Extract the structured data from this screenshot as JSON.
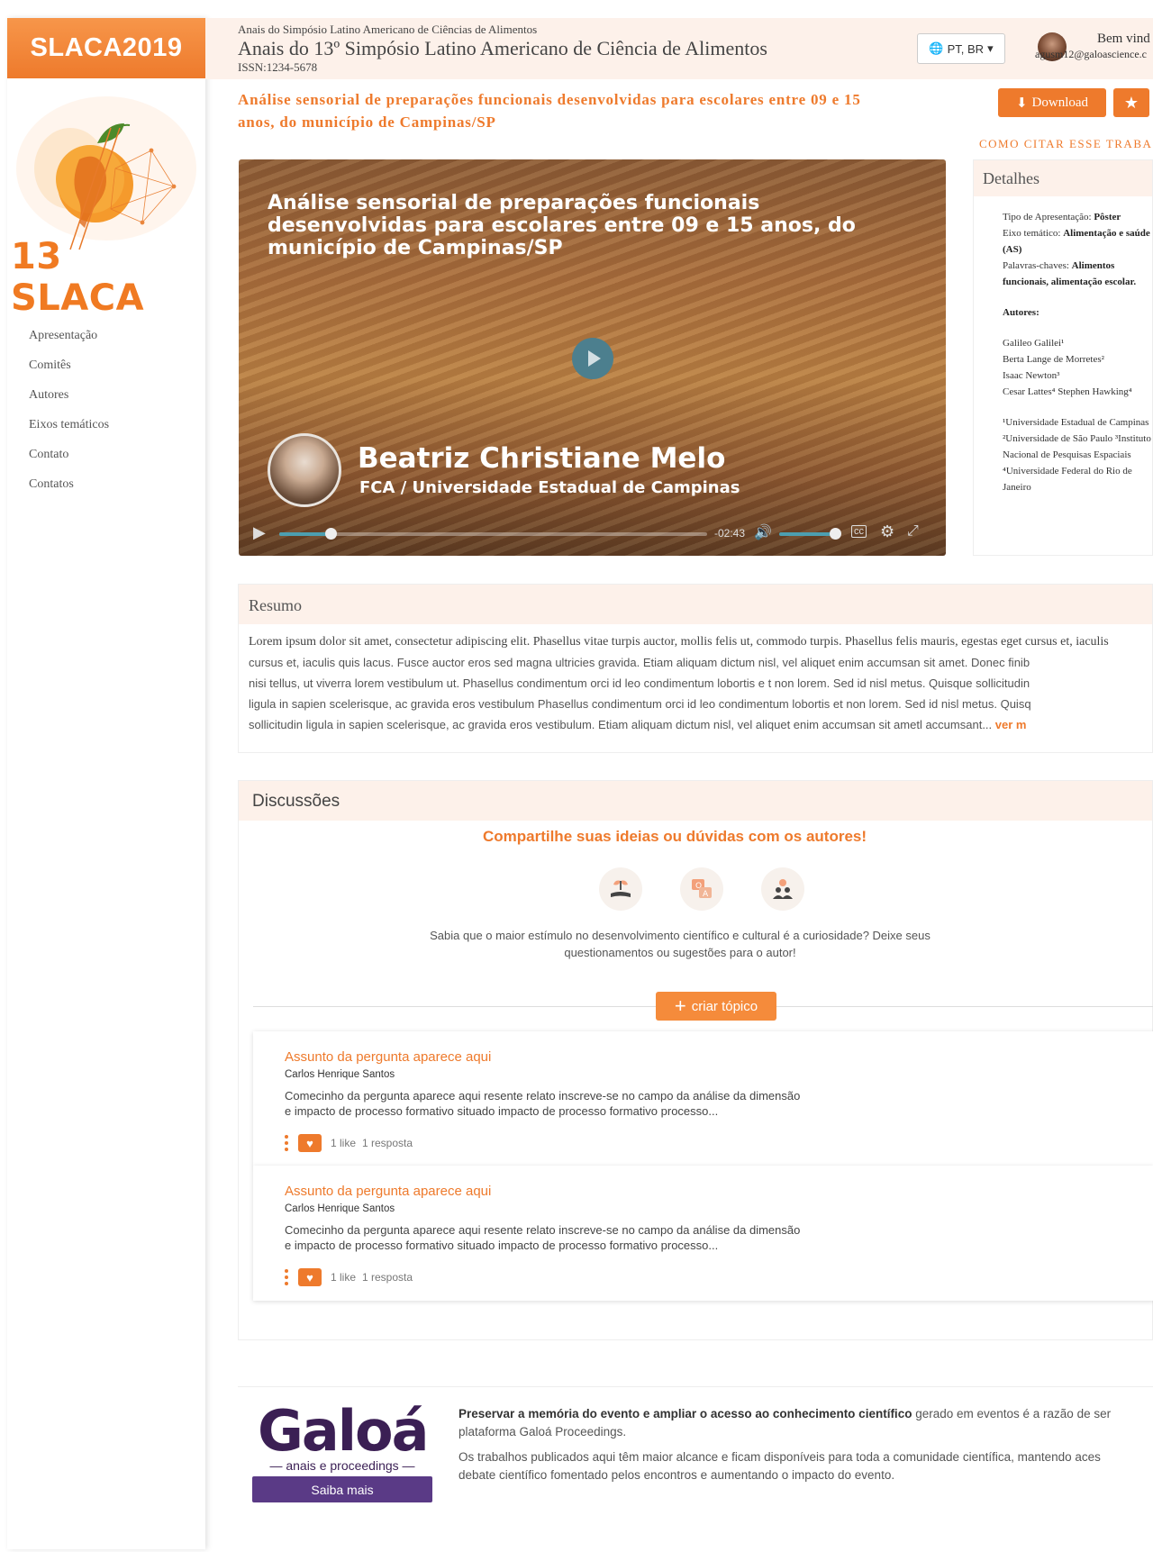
{
  "sidebar": {
    "brand": "SLACA2019",
    "logo_text": "13 SLACA",
    "items": [
      {
        "label": "Apresentação"
      },
      {
        "label": "Comitês"
      },
      {
        "label": "Autores"
      },
      {
        "label": "Eixos temáticos"
      },
      {
        "label": "Contato"
      },
      {
        "label": "Contatos"
      }
    ]
  },
  "header": {
    "small": "Anais do Simpósio Latino Americano de Ciências de Alimentos",
    "title": "Anais do 13º Simpósio Latino Americano de Ciência de Alimentos",
    "issn": "ISSN:1234-5678",
    "language": "PT, BR",
    "welcome": "Bem vind",
    "email": "agusm12@galoascience.c"
  },
  "article": {
    "title": "Análise sensorial de preparações funcionais desenvolvidas para escolares entre 09 e 15 anos, do município de Campinas/SP",
    "download_label": "Download",
    "cite_label": "COMO CITAR ESSE TRABA"
  },
  "video": {
    "title": "Análise sensorial de preparações funcionais desenvolvidas para escolares entre 09 e 15 anos, do município de Campinas/SP",
    "presenter_name": "Beatriz Christiane Melo",
    "presenter_affiliation": "FCA / Universidade Estadual de Campinas",
    "time_remaining": "-02:43",
    "progress": 0.12,
    "volume": 1.0
  },
  "details": {
    "heading": "Detalhes",
    "tipo_label": "Tipo de Apresentação: ",
    "tipo_value": "Pôster",
    "eixo_label": "Eixo temático: ",
    "eixo_value": "Alimentação e saúde (AS)",
    "palavras_label": "Palavras-chaves: ",
    "palavras_value": "Alimentos funcionais, alimentação escolar.",
    "autores_label": "Autores:",
    "authors": [
      "Galileo Galilei¹",
      "Berta Lange de Morretes²",
      "Isaac Newton³",
      "Cesar Lattes⁴ Stephen Hawking⁴"
    ],
    "affiliations": "¹Universidade Estadual de Campinas ²Universidade de São Paulo ³Instituto Nacional de Pesquisas Espaciais ⁴Universidade Federal do Rio de Janeiro"
  },
  "resumo": {
    "heading": "Resumo",
    "line1": "Lorem ipsum dolor sit amet, consectetur adipiscing elit. Phasellus vitae turpis auctor, mollis felis ut, commodo turpis. Phasellus felis mauris, egestas eget cursus et, iaculis",
    "line2": "cursus et, iaculis quis lacus. Fusce auctor eros sed magna ultricies gravida. Etiam aliquam dictum nisl, vel aliquet enim accumsan sit amet. Donec finib",
    "line3": "nisi tellus, ut viverra lorem vestibulum ut. Phasellus condimentum orci id leo condimentum lobortis e t non lorem. Sed id nisl metus. Quisque sollicitudin",
    "line4": "ligula in sapien scelerisque, ac gravida eros vestibulum Phasellus condimentum orci id leo condimentum lobortis et non lorem. Sed id nisl metus. Quisq",
    "line5": "sollicitudin ligula in sapien scelerisque, ac gravida eros vestibulum. Etiam aliquam dictum nisl, vel aliquet enim accumsan sit ametl accumsant...",
    "more": "ver m"
  },
  "discussions": {
    "heading": "Discussões",
    "cta": "Compartilhe suas ideias ou dúvidas com os autores!",
    "text": "Sabia que o maior estímulo no desenvolvimento científico e cultural é a curiosidade? Deixe seus questionamentos ou sugestões para o autor!",
    "create_topic": "criar tópico",
    "icons": [
      "plant-hand-icon",
      "qa-icon",
      "people-icon"
    ],
    "topics": [
      {
        "title": "Assunto da pergunta aparece aqui",
        "author": "Carlos Henrique Santos",
        "body": "Comecinho da pergunta aparece aqui resente relato inscreve-se no campo da análise da dimensão e impacto de processo formativo situado impacto de processo formativo processo...",
        "likes": "1 like",
        "replies": "1 resposta"
      },
      {
        "title": "Assunto da pergunta aparece aqui",
        "author": "Carlos Henrique Santos",
        "body": "Comecinho da pergunta aparece aqui resente relato inscreve-se no campo da análise da dimensão e impacto de processo formativo situado impacto de processo formativo processo...",
        "likes": "1 like",
        "replies": "1 resposta"
      }
    ]
  },
  "footer": {
    "logo": "Galoá",
    "logo_sub": "— anais e proceedings —",
    "saiba_mais": "Saiba mais",
    "p1_bold": "Preservar a memória do evento e ampliar o acesso ao conhecimento científico",
    "p1_rest": " gerado em eventos é a razão de ser",
    "p1_line2": "plataforma Galoá Proceedings.",
    "p2_line1": "Os trabalhos publicados aqui têm maior alcance e ficam disponíveis para toda a comunidade científica, mantendo aces",
    "p2_line2": "debate científico fomentado pelos encontros e aumentando o impacto do evento."
  },
  "colors": {
    "accent": "#ee7a2c",
    "header_bg": "#fdf1ea",
    "galoa_purple": "#3b1f54"
  }
}
